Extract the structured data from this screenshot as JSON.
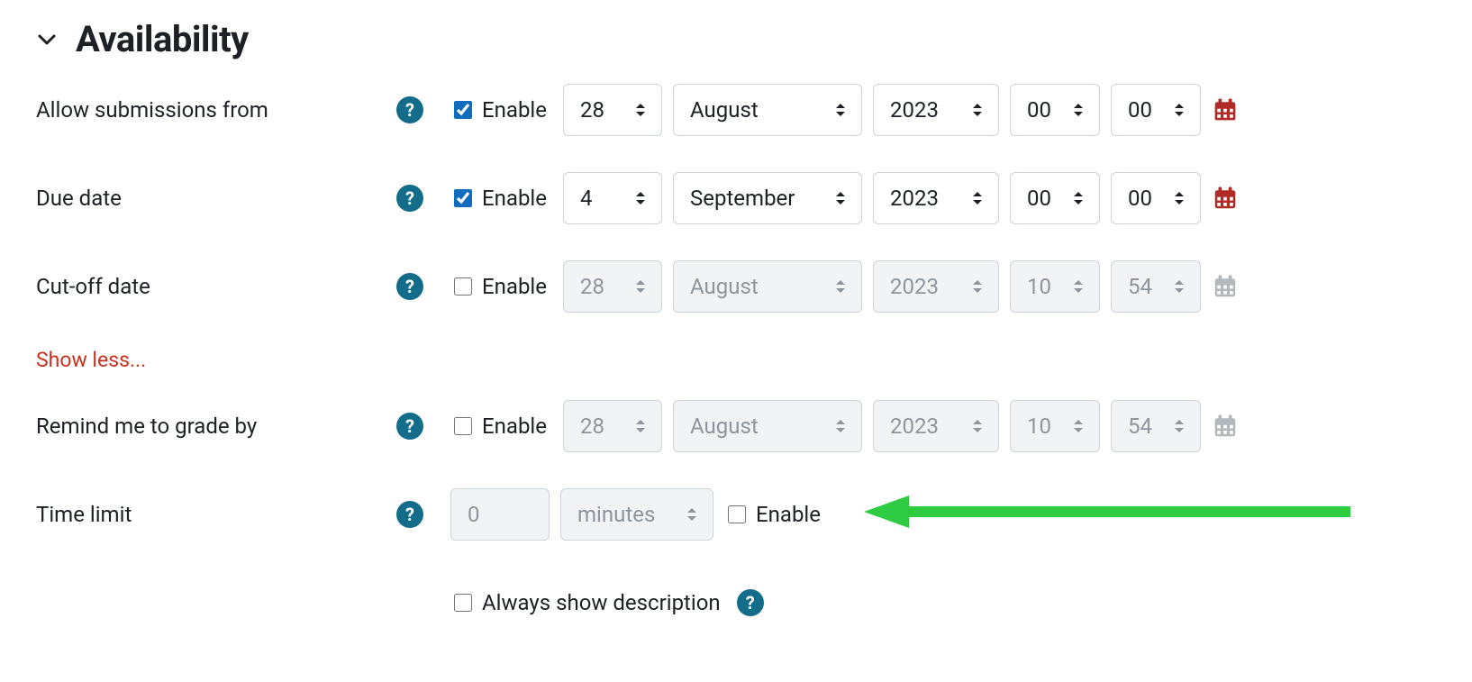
{
  "section": {
    "title": "Availability"
  },
  "common": {
    "enable_label": "Enable",
    "show_less": "Show less..."
  },
  "rows": {
    "allow": {
      "label": "Allow submissions from",
      "enabled": true,
      "day": "28",
      "month": "August",
      "year": "2023",
      "hour": "00",
      "minute": "00"
    },
    "due": {
      "label": "Due date",
      "enabled": true,
      "day": "4",
      "month": "September",
      "year": "2023",
      "hour": "00",
      "minute": "00"
    },
    "cutoff": {
      "label": "Cut-off date",
      "enabled": false,
      "day": "28",
      "month": "August",
      "year": "2023",
      "hour": "10",
      "minute": "54"
    },
    "remind": {
      "label": "Remind me to grade by",
      "enabled": false,
      "day": "28",
      "month": "August",
      "year": "2023",
      "hour": "10",
      "minute": "54"
    },
    "timelimit": {
      "label": "Time limit",
      "enabled": false,
      "value": "0",
      "unit": "minutes"
    }
  },
  "always_desc": {
    "label": "Always show description",
    "checked": false
  }
}
